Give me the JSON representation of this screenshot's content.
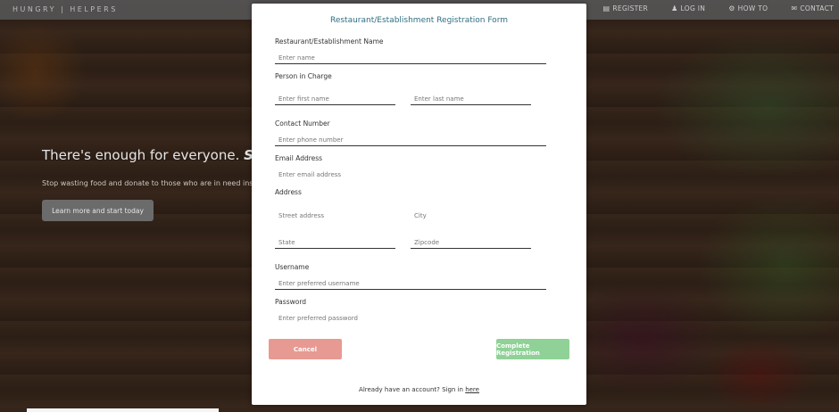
{
  "navbar": {
    "brand": "HUNGRY | HELPERS",
    "links": [
      {
        "label": "REGISTER",
        "icon": "register-icon"
      },
      {
        "label": "LOG IN",
        "icon": "user-icon"
      },
      {
        "label": "HOW TO",
        "icon": "gear-icon"
      },
      {
        "label": "CONTACT",
        "icon": "contact-icon"
      }
    ]
  },
  "hero": {
    "title_plain": "There's enough for everyone.",
    "title_em": "SHA",
    "subtitle": "Stop wasting food and donate to those who are in need inst",
    "cta_label": "Learn more and start today"
  },
  "modal": {
    "title": "Restaurant/Establishment Registration Form",
    "fields": {
      "establishment_label": "Restaurant/Establishment Name",
      "establishment_placeholder": "Enter name",
      "person_label": "Person in Charge",
      "first_name_placeholder": "Enter first name",
      "last_name_placeholder": "Enter last name",
      "contact_label": "Contact Number",
      "contact_placeholder": "Enter phone number",
      "email_label": "Email Address",
      "email_placeholder": "Enter email address",
      "address_label": "Address",
      "street_placeholder": "Street address",
      "city_placeholder": "City",
      "state_placeholder": "State",
      "zip_placeholder": "Zipcode",
      "username_label": "Username",
      "username_placeholder": "Enter preferred username",
      "password_label": "Password",
      "password_placeholder": "Enter preferred password"
    },
    "cancel_label": "Cancel",
    "complete_label": "Complete Registration",
    "footer_text": "Already have an account? Sign in",
    "footer_link": "here",
    "colors": {
      "title": "#2e6f82",
      "cancel": "#e79a92",
      "complete": "#8fd196"
    }
  }
}
